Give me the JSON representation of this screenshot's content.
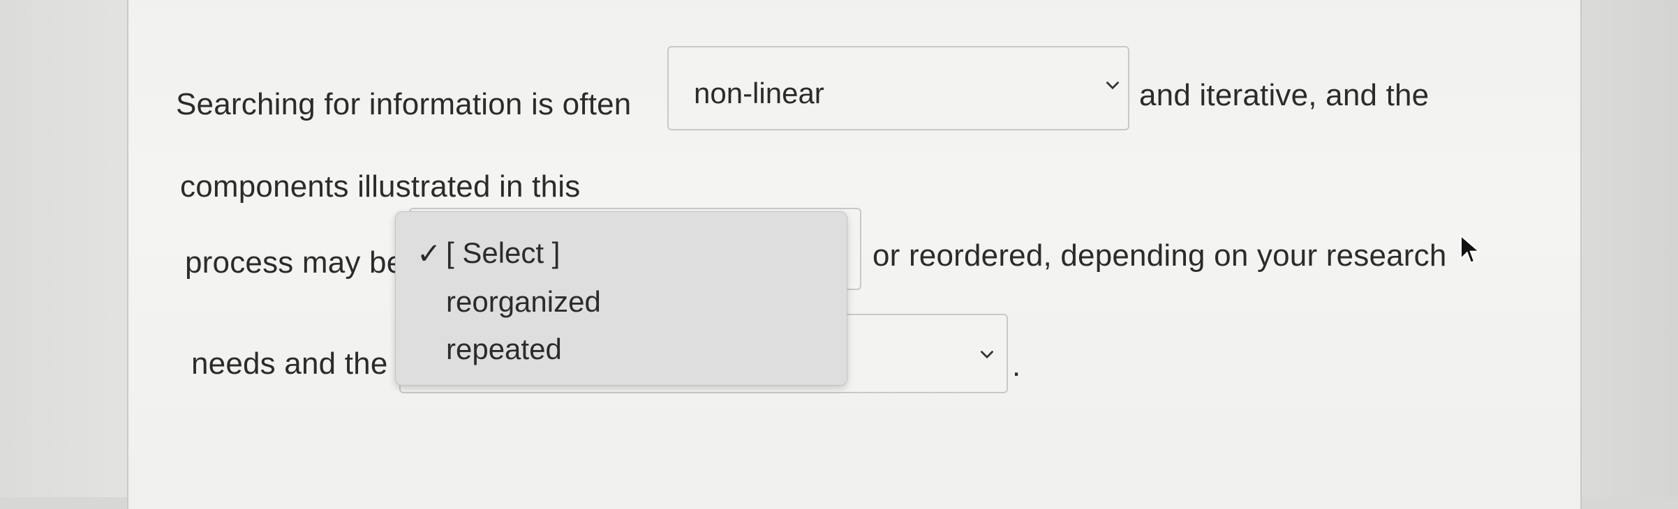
{
  "sentence": {
    "line1_prefix": "Searching for information is often",
    "line1_suffix": "and iterative, and the",
    "line2": "components illustrated in this",
    "line3_prefix": "process may be",
    "line3_suffix": "or reordered, depending on your research",
    "line4_prefix": "needs and the",
    "line4_suffix": "."
  },
  "select1": {
    "value": "non-linear"
  },
  "select2": {
    "value": "[ Select ]"
  },
  "select3": {
    "value": ""
  },
  "dropdown": {
    "check_mark": "✓",
    "options": [
      "[ Select ]",
      "reorganized",
      "repeated"
    ],
    "selected_index": 0
  },
  "icons": {
    "chevron": "chevron-down-icon",
    "check": "checkmark-icon",
    "cursor": "mouse-pointer-icon"
  }
}
